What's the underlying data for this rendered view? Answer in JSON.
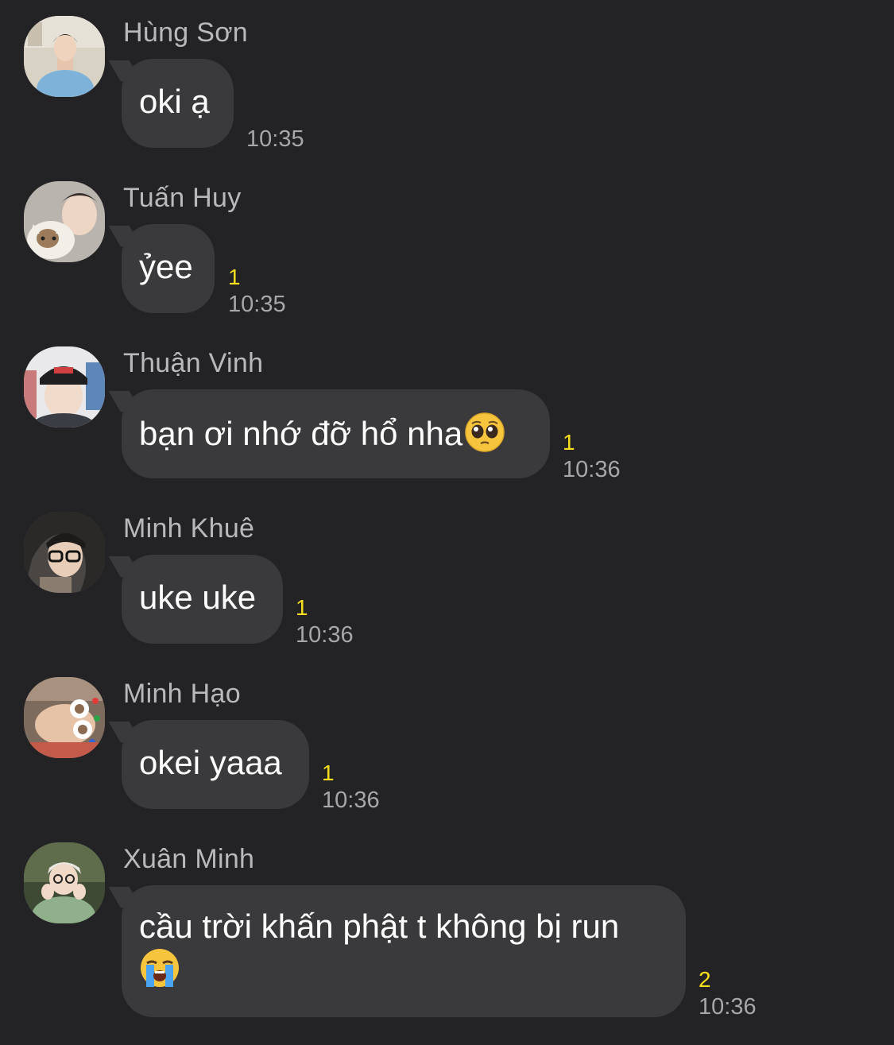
{
  "messages": [
    {
      "sender": "Hùng Sơn",
      "text": "oki ạ",
      "unread": "",
      "time": "10:35",
      "avatar": "avatar-hung-son"
    },
    {
      "sender": "Tuấn Huy",
      "text": "ỷee",
      "unread": "1",
      "time": "10:35",
      "avatar": "avatar-tuan-huy"
    },
    {
      "sender": "Thuận Vinh",
      "text": "bạn ơi nhớ đỡ hổ nha",
      "emoji": "pleading-face-emoji",
      "unread": "1",
      "time": "10:36",
      "avatar": "avatar-thuan-vinh"
    },
    {
      "sender": "Minh Khuê",
      "text": "uke uke",
      "unread": "1",
      "time": "10:36",
      "avatar": "avatar-minh-khue"
    },
    {
      "sender": "Minh Hạo",
      "text": "okei yaaa",
      "unread": "1",
      "time": "10:36",
      "avatar": "avatar-minh-hao"
    },
    {
      "sender": "Xuân Minh",
      "text": "cầu trời khấn phật t không bị run",
      "emoji": "loudly-crying-face-emoji",
      "unread": "2",
      "time": "10:36",
      "avatar": "avatar-xuan-minh"
    }
  ],
  "colors": {
    "background": "#232325",
    "bubble": "#3a3a3c",
    "unread": "#f5de1c",
    "sender": "#b9b9bd",
    "time": "#a6a6ab"
  }
}
